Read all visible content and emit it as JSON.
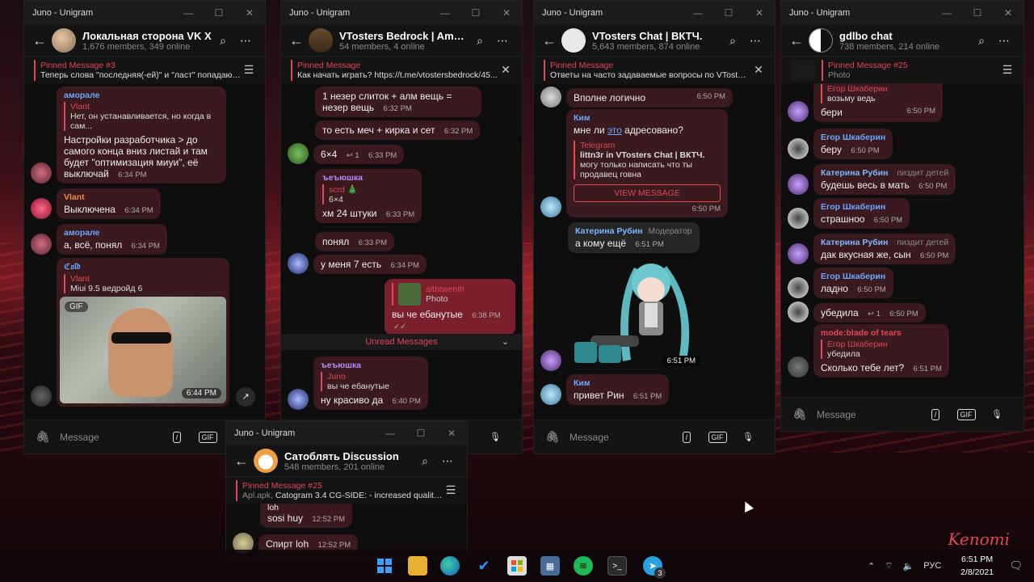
{
  "taskbar": {
    "time": "6:51 PM",
    "date": "2/8/2021",
    "lang": "РУС",
    "telegram_badge": "3"
  },
  "w1": {
    "title": "Juno - Unigram",
    "chat_name": "Локальная сторона VK X",
    "chat_sub": "1,676 members, 349 online",
    "pinned_title": "Pinned Message #3",
    "pinned_text": "Теперь слова \"последняя(-ей)\" и \"ласт\" попадают...",
    "input_placeholder": "Message",
    "gif_label": "GIF",
    "messages": [
      {
        "sender": "аморале",
        "reply_name": "Vlant",
        "reply_text": "Нет, он устанавливается, но когда в сам...",
        "text": "Настройки разработчика > до самого конца вниз листай и там будет \"оптимизация миуи\", её выключай",
        "time": "6:34 PM"
      },
      {
        "sender": "Vlant",
        "text": "Выключена",
        "time": "6:34 PM"
      },
      {
        "sender": "аморале",
        "text": "а, всё, понял",
        "time": "6:34 PM"
      },
      {
        "sender": "ℭ𝔬𝔩𝔡",
        "reply_name": "Vlant",
        "reply_text": "Miui 9.5 ведройд 6",
        "media_tag": "GIF",
        "time": "6:44 PM"
      }
    ]
  },
  "w2": {
    "title": "Juno - Unigram",
    "chat_name": "VTosters Bedrock | Amon...",
    "chat_sub": "54 members, 4 online",
    "pinned_title": "Pinned Message",
    "pinned_text": "Как начать играть?  https://t.me/vtostersbedrock/45...",
    "unread": "Unread Messages",
    "messages": [
      {
        "text": "1 незер слиток + алм вещь = незер вещь",
        "time": "6:32 PM"
      },
      {
        "text": "то есть меч + кирка и сет",
        "time": "6:32 PM"
      },
      {
        "text": "6×4",
        "replies": "1",
        "time": "6:33 PM"
      },
      {
        "sender": "ъеъюшка",
        "reply_name": "scrd 🎄",
        "reply_text": "6×4",
        "text": "хм 24 штуки",
        "time": "6:33 PM"
      },
      {
        "text": "понял",
        "time": "6:33 PM"
      },
      {
        "text": "у меня 7 есть",
        "time": "6:34 PM"
      },
      {
        "reply_name": "althtwenth",
        "reply_text": "Photo",
        "text": "вы че ебанутые",
        "time": "6:38 PM"
      },
      {
        "sender": "ъеъюшка",
        "reply_name": "Juno",
        "reply_text": "вы че ебанутые",
        "text": "ну красиво да",
        "time": "6:40 PM"
      }
    ]
  },
  "w3": {
    "title": "Juno - Unigram",
    "chat_name": "VTosters Chat | ВКТЧ.",
    "chat_sub": "5,643 members, 874 online",
    "pinned_title": "Pinned Message",
    "pinned_text": "Ответы на часто задаваемые вопросы по VTosters...",
    "input_placeholder": "Message",
    "messages": [
      {
        "text": "Вполне логично",
        "time": "6:50 PM"
      },
      {
        "sender": "Ким",
        "text_pre": "мне ли ",
        "text_link": "это",
        "text_post": " адресовано?",
        "fwd_name": "Telegram",
        "fwd_title": "littn3r in VTosters Chat | ВКТЧ.",
        "fwd_text": "могу только написать что ты продавец говна",
        "button": "VIEW MESSAGE",
        "time": "6:50 PM"
      },
      {
        "sender": "Катерина Рубин",
        "role": "Модератор",
        "text": "а кому ещё",
        "time": "6:51 PM"
      },
      {
        "sticker_time": "6:51 PM"
      },
      {
        "sender": "Ким",
        "text": "привет Рин",
        "time": "6:51 PM"
      }
    ]
  },
  "w4": {
    "title": "Juno - Unigram",
    "chat_name": "gdlbo chat",
    "chat_sub": "738 members, 214 online",
    "pinned_title": "Pinned Message #25",
    "pinned_text": "Photo",
    "input_placeholder": "Message",
    "messages": [
      {
        "reply_name": "Егор Шкаберин",
        "reply_text": "возьму ведь",
        "text": "бери",
        "time": "6:50 PM"
      },
      {
        "sender": "Егор Шкаберин",
        "text": "беру",
        "time": "6:50 PM"
      },
      {
        "sender": "Катерина Рубин",
        "role": "пиздит детей",
        "text": "будешь весь в мать",
        "time": "6:50 PM"
      },
      {
        "sender": "Егор Шкаберин",
        "text": "страшноо",
        "time": "6:50 PM"
      },
      {
        "sender": "Катерина Рубин",
        "role": "пиздит детей",
        "text": "дак вкусная же, сын",
        "time": "6:50 PM"
      },
      {
        "sender": "Егор Шкаберин",
        "text": "ладно",
        "time": "6:50 PM"
      },
      {
        "text": "убедила",
        "replies": "1",
        "time": "6:50 PM"
      },
      {
        "sender": "mode:blade of tears",
        "reply_name": "Егор Шкаберин",
        "reply_text": "убедила",
        "text": "Сколько тебе лет?",
        "time": "6:51 PM"
      }
    ]
  },
  "w5": {
    "title": "Juno - Unigram",
    "chat_name": "Сатоблять Discussion",
    "chat_sub": "548 members, 201 online",
    "pinned_title": "Pinned Message #25",
    "pinned_text_a": "Apl.apk, ",
    "pinned_text_b": "Catogram 3.4  CG-SIDE:  - increased quality...",
    "messages": [
      {
        "text_top": "loh",
        "text": "sosi huy",
        "time": "12:52 PM"
      },
      {
        "text": "Спирт loh",
        "time": "12:52 PM"
      }
    ]
  },
  "signature": "Kenomi",
  "colors": {
    "accent": "#e0475a",
    "bubble_in": "#3a1a1e",
    "bubble_out": "#7a1f2b",
    "link": "#6aa7ff"
  }
}
